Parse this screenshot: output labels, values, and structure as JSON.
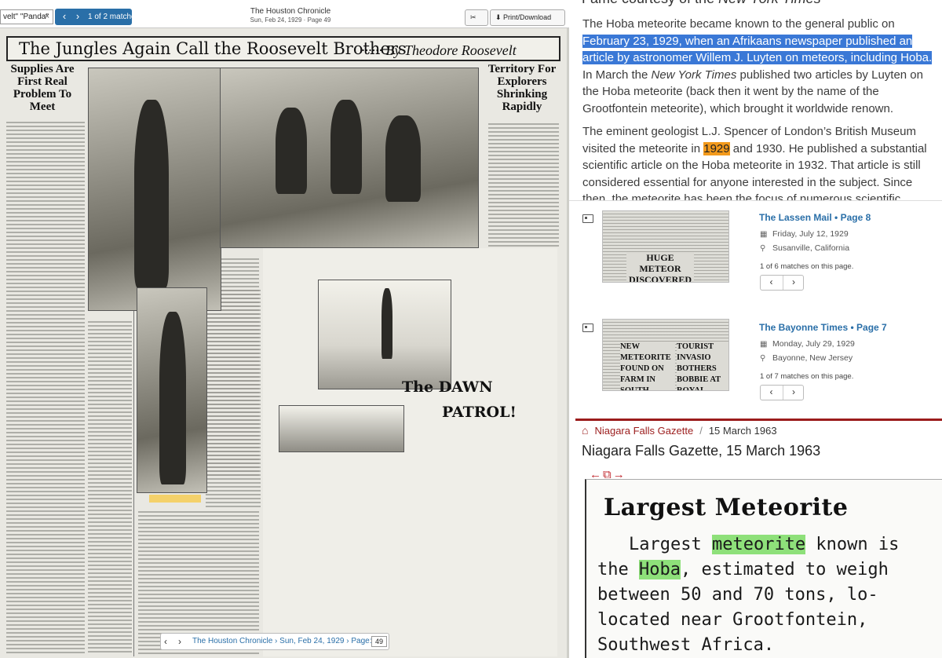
{
  "viewer": {
    "search_value": "velt\" \"Panda\"",
    "match_count": "1 of 2 matches",
    "publication": "The Houston Chronicle",
    "date_page": "Sun, Feb 24, 1929 · Page 49",
    "clip_label": "Clip",
    "print_label": "Print/Download",
    "prev_arrow": "‹",
    "next_arrow": "›",
    "clear_icon": "×",
    "clip_icon": "scissors-icon",
    "print_icon": "download-icon"
  },
  "newspaper": {
    "headline": "The Jungles Again Call the Roosevelt Brothers",
    "byline": "······ By Theodore Roosevelt",
    "subhead_left": "Supplies Are First Real Problem To Meet",
    "subhead_right": "Territory For Explorers Shrinking Rapidly",
    "dawn_title_1": "The DAWN",
    "dawn_title_2": "PATROL!"
  },
  "bottom_nav": {
    "prev": "‹",
    "next": "›",
    "breadcrumb": "The Houston Chronicle  ›  Sun, Feb 24, 1929  ›  Page:",
    "page_value": "49"
  },
  "article": {
    "heading_plain": "Fame courtesy of the ",
    "heading_italic": "New York Times",
    "p1_a": "The Hoba meteorite became known to the general public on ",
    "p1_highlight": "February 23, 1929, when an Afrikaans newspaper published an article by astronomer Willem J. Luyten on meteors, including Hoba.",
    "p1_b": " In March the ",
    "p1_italic": "New York Times",
    "p1_c": " published two articles by Luyten on the Hoba meteorite (back then it went by the name of the Grootfontein meteorite), which brought it worldwide renown.",
    "p2_a": "The eminent geologist L.J. Spencer of London’s British Museum visited the meteorite in ",
    "p2_highlight": "1929",
    "p2_b": " and 1930. He published a substantial scientific article on the Hoba meteorite in 1932. That article is still considered essential for anyone interested in the subject. Since then, the meteorite has been the focus of numerous scientific studies."
  },
  "results": [
    {
      "title": "The Lassen Mail • Page 8",
      "date": "Friday, July 12, 1929",
      "location": "Susanville, California",
      "matches": "1 of 6 matches on this page.",
      "thumb_head": "HUGE METEOR DISCOVERED IN SOUTH AFRICA",
      "calendar_icon": "calendar-icon",
      "pin_icon": "location-pin-icon"
    },
    {
      "title": "The Bayonne Times • Page 7",
      "date": "Monday, July 29, 1929",
      "location": "Bayonne, New Jersey",
      "matches": "1 of 7 matches on this page.",
      "thumb_head": "NEW METEORITE FOUND ON FARM IN SOUTH AFRICA",
      "thumb_head_2": "TOURIST INVASIO BOTHERS BOBBIE AT ROYAL PALAC",
      "calendar_icon": "calendar-icon",
      "pin_icon": "location-pin-icon"
    }
  ],
  "gazette": {
    "crumb_link": "Niagara Falls Gazette",
    "crumb_sep": "/",
    "crumb_date": "15 March 1963",
    "title": "Niagara Falls Gazette, 15 March 1963",
    "tools": "←⧉→",
    "clip_headline": "Largest Meteorite",
    "line1_a": "Largest ",
    "line1_hl": "meteorite",
    "line1_b": " known is",
    "line2_a": "the ",
    "line2_hl": "Hoba",
    "line2_b": ", estimated to weigh",
    "line3": "between 50 and 70 tons, lo-",
    "line4": "located near Grootfontein,",
    "line5": "Southwest Africa."
  },
  "colors": {
    "accent_blue": "#2a6fa8",
    "highlight_blue": "#3a78d6",
    "highlight_orange": "#f39a1c",
    "highlight_green": "#8ee07a",
    "gazette_red": "#9b1c1c"
  }
}
